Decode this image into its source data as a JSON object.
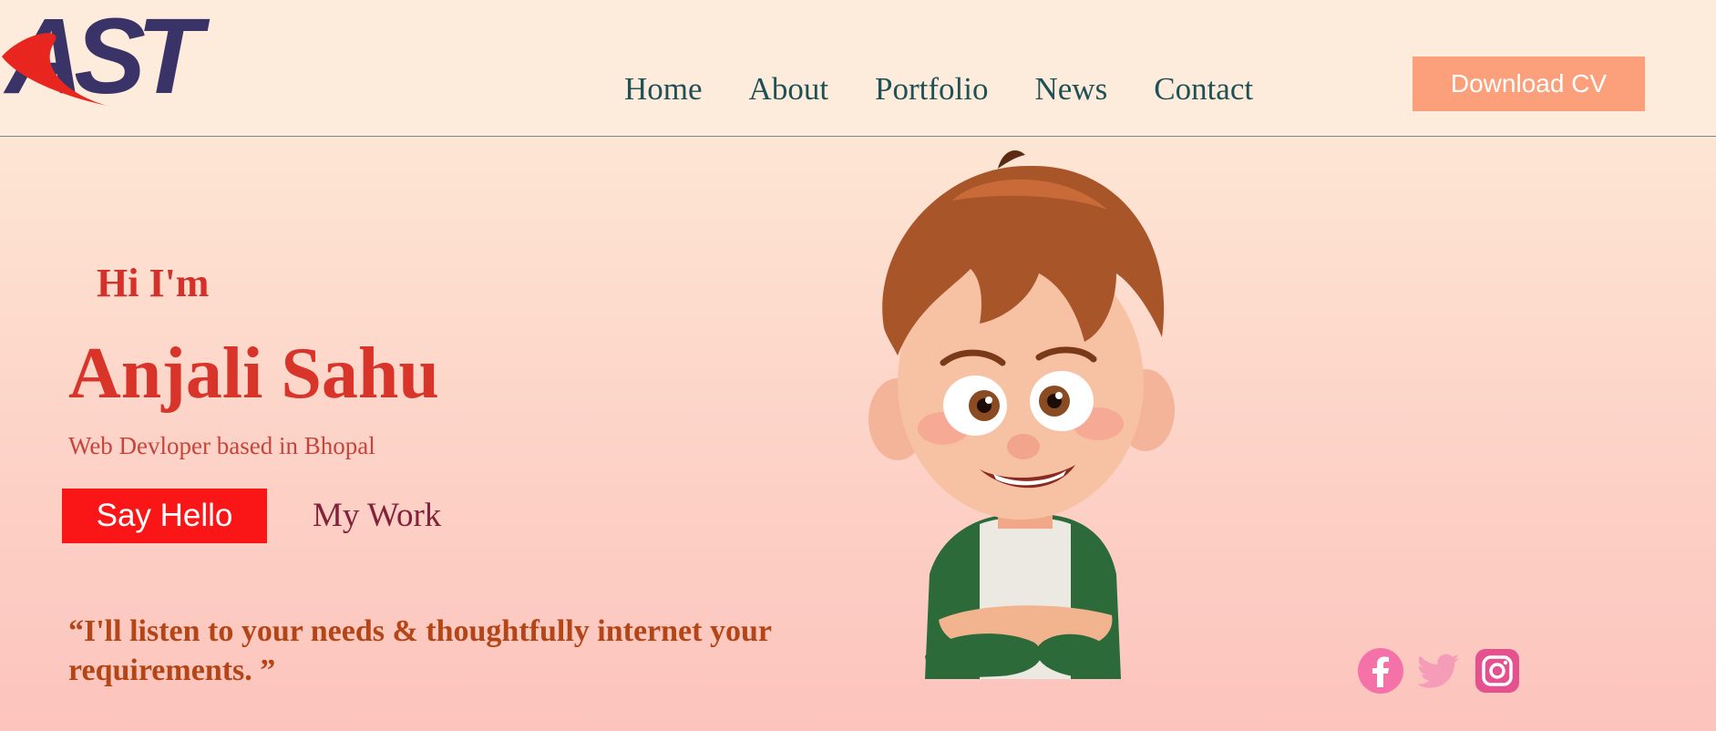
{
  "logo": {
    "text": "AST",
    "icon": "ast-logo-icon"
  },
  "nav": {
    "items": [
      {
        "label": "Home"
      },
      {
        "label": "About"
      },
      {
        "label": "Portfolio"
      },
      {
        "label": "News"
      },
      {
        "label": "Contact"
      }
    ]
  },
  "header": {
    "cv_button_label": "Download CV"
  },
  "hero": {
    "greeting": "Hi I'm",
    "name": "Anjali Sahu",
    "subtitle": "Web Devloper based in Bhopal",
    "primary_button_label": "Say Hello",
    "secondary_link_label": "My Work",
    "quote": "“I'll listen to your needs & thoughtfully internet your requirements. ”",
    "avatar_icon": "cartoon-boy-avatar-icon"
  },
  "socials": [
    {
      "icon": "facebook-icon"
    },
    {
      "icon": "twitter-icon"
    },
    {
      "icon": "instagram-icon"
    }
  ],
  "colors": {
    "accent_red": "#fa1617",
    "heading_red": "#d9342a",
    "nav_text": "#1f5056",
    "cv_button": "#fba07a",
    "logo_navy": "#3a3367",
    "social_pink": "#f472a8"
  }
}
